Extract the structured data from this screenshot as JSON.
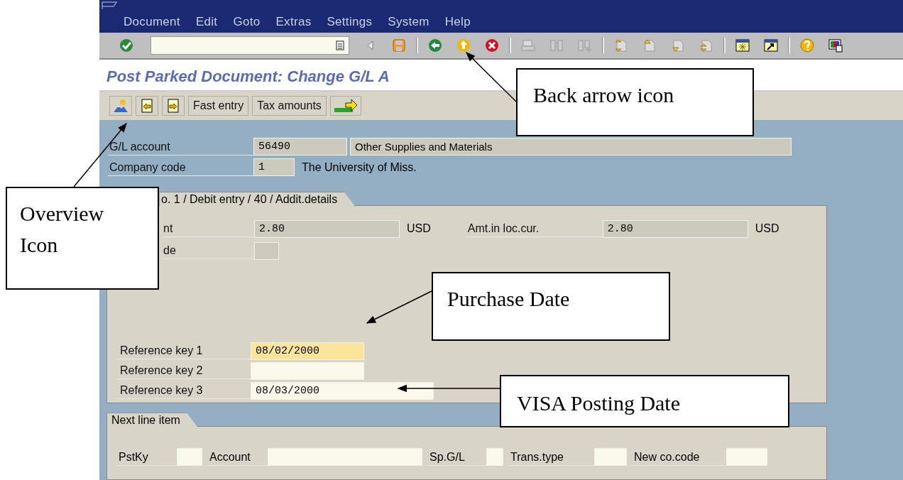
{
  "menu_bar": {
    "items": [
      "Document",
      "Edit",
      "Goto",
      "Extras",
      "Settings",
      "System",
      "Help"
    ]
  },
  "title": "Post Parked Document: Change G/L A",
  "app_toolbar": {
    "buttons": [
      "Fast entry",
      "Tax amounts"
    ]
  },
  "header": {
    "rows": [
      {
        "label": "G/L account",
        "fields": [
          {
            "value": "56490",
            "editable": false
          },
          {
            "value": "Other Supplies and Materials",
            "editable": false
          }
        ]
      },
      {
        "label": "Company code",
        "fields": [
          {
            "value": "1",
            "editable": false
          }
        ],
        "text": "The University of Miss."
      }
    ]
  },
  "detail_panel": {
    "tab": "o. 1 / Debit entry / 40 / Addit.details",
    "amount_row": {
      "label": "nt",
      "value": "2.80",
      "currency": "USD",
      "loc_label": "Amt.in loc.cur.",
      "loc_value": "2.80",
      "loc_currency": "USD"
    },
    "code_row": {
      "label": "de"
    },
    "reference_keys": [
      {
        "label": "Reference key 1",
        "value": "08/02/2000",
        "focused": true
      },
      {
        "label": "Reference key 2",
        "focused": false
      },
      {
        "label": "Reference key 3",
        "value": "08/03/2000",
        "focused": false
      }
    ]
  },
  "next_line_item": {
    "tab": "Next line item",
    "fields": [
      {
        "label": "PstKy"
      },
      {
        "label": "Account"
      },
      {
        "label": "Sp.G/L"
      },
      {
        "label": "Trans.type"
      },
      {
        "label": "New co.code"
      }
    ]
  },
  "callouts": [
    {
      "text": "Back arrow icon"
    },
    {
      "text": "Overview Icon"
    },
    {
      "text": "Purchase Date"
    },
    {
      "text": "VISA Posting Date"
    }
  ]
}
